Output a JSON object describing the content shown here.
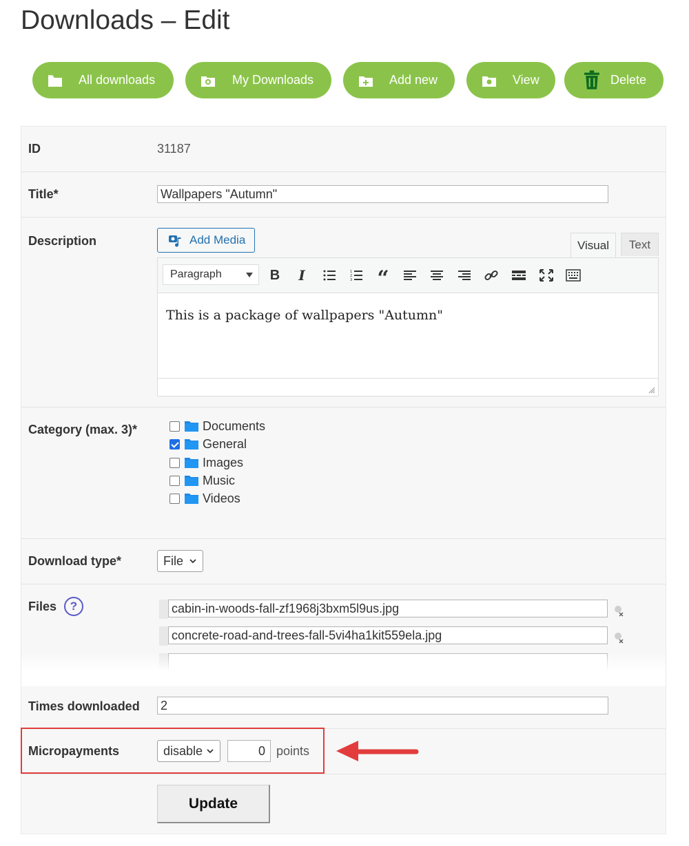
{
  "page": {
    "title": "Downloads – Edit"
  },
  "toolbar": {
    "buttons": [
      {
        "label": "All downloads",
        "icon": "folder-icon"
      },
      {
        "label": "My Downloads",
        "icon": "folder-camera-icon"
      },
      {
        "label": "Add new",
        "icon": "folder-plus-icon"
      },
      {
        "label": "View",
        "icon": "folder-eye-icon"
      },
      {
        "label": "Delete",
        "icon": "trash-icon"
      }
    ],
    "accent_color": "#8bc34a"
  },
  "form": {
    "id": {
      "label": "ID",
      "value": "31187"
    },
    "title": {
      "label": "Title*",
      "value": "Wallpapers \"Autumn\""
    },
    "description": {
      "label": "Description",
      "add_media_label": "Add Media",
      "tabs": [
        "Visual",
        "Text"
      ],
      "active_tab": "Visual",
      "format_select": "Paragraph",
      "content": "This is a package of wallpapers \"Autumn\""
    },
    "category": {
      "label": "Category (max. 3)*",
      "items": [
        {
          "name": "Documents",
          "checked": false
        },
        {
          "name": "General",
          "checked": true
        },
        {
          "name": "Images",
          "checked": false
        },
        {
          "name": "Music",
          "checked": false
        },
        {
          "name": "Videos",
          "checked": false
        }
      ]
    },
    "download_type": {
      "label": "Download type*",
      "value": "File"
    },
    "files": {
      "label": "Files",
      "help_icon": "?",
      "items": [
        "cabin-in-woods-fall-zf1968j3bxm5l9us.jpg",
        "concrete-road-and-trees-fall-5vi4ha1kit559ela.jpg"
      ]
    },
    "times_downloaded": {
      "label": "Times downloaded",
      "value": "2"
    },
    "micropayments": {
      "label": "Micropayments",
      "select": "disable",
      "points_value": "0",
      "points_label": "points"
    },
    "submit_label": "Update"
  },
  "annotation": {
    "highlight_color": "#e23c3c"
  }
}
